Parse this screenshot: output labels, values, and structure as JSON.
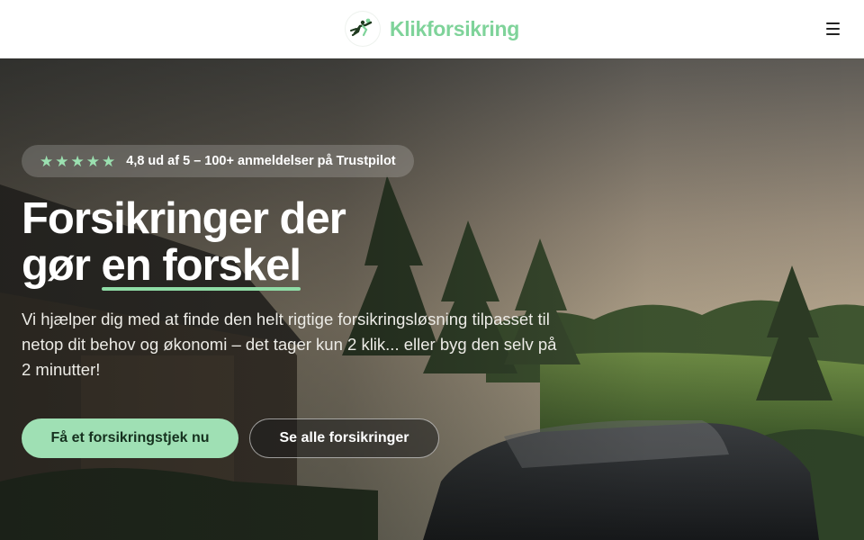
{
  "header": {
    "brand_name": "Klikforsikring",
    "logo_icon": "running-figures-logo",
    "menu_icon": "hamburger-menu-icon"
  },
  "hero": {
    "rating": {
      "stars": 5,
      "star_color": "#9be0b0",
      "text": "4,8 ud af 5 – 100+ anmeldelser på Trustpilot"
    },
    "headline_line1": "Forsikringer der",
    "headline_line2_prefix": "gør ",
    "headline_line2_highlight": "en forskel",
    "lead": "Vi hjælper dig med at finde den helt rigtige forsikringsløsning tilpasset til netop dit behov og økonomi – det tager kun 2 klik... eller byg den selv på 2 minutter!",
    "primary_cta": "Få et forsikringstjek nu",
    "secondary_cta": "Se alle forsikringer"
  },
  "colors": {
    "brand_green": "#7fd39a",
    "accent_green": "#9fe0b4"
  }
}
